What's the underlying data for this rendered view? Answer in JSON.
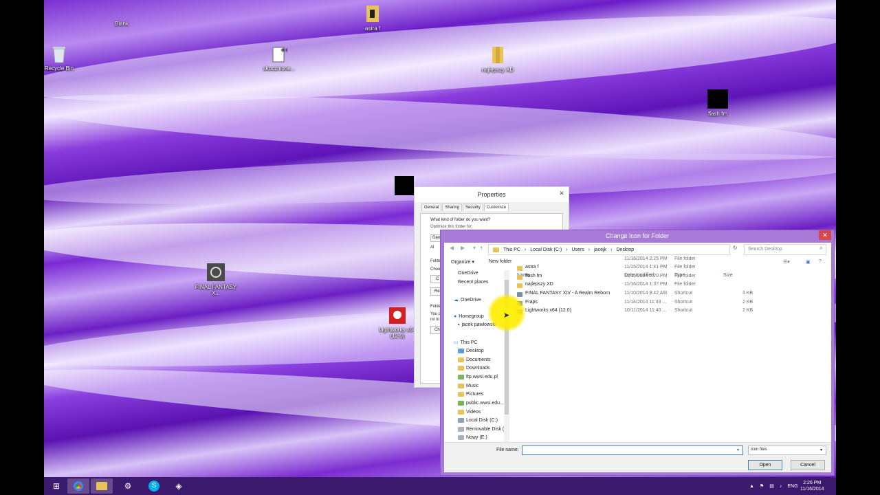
{
  "desktop": {
    "icons": [
      {
        "label": "Blank",
        "icon": "blank-file-icon"
      },
      {
        "label": "astra f",
        "icon": "music-folder-icon"
      },
      {
        "label": "Recycle Bin",
        "icon": "recycle-bin-icon"
      },
      {
        "label": "skocznione...",
        "icon": "document-icon"
      },
      {
        "label": "najlepszy XD",
        "icon": "folder-icon"
      },
      {
        "label": "flash fm",
        "icon": "black-square-icon"
      },
      {
        "label": "FINAL FANTASY X...",
        "icon": "game-icon"
      },
      {
        "label": "Lightworks x64 (12.0)",
        "icon": "lightworks-icon"
      }
    ]
  },
  "properties": {
    "title": "Properties",
    "tabs": [
      "General",
      "Sharing",
      "Security",
      "Customize"
    ],
    "question": "What kind of folder do you want?",
    "optimize_label": "Optimize this folder for:",
    "frag_gen": "Gen",
    "frag_all": "Al",
    "frag_folder": "Folde",
    "frag_choo": "Choo",
    "frag_c1": "C",
    "frag_r": "Re",
    "frag_folder2": "Folde",
    "frag_you": "You c",
    "frag_nolo": "no lo",
    "frag_ch": "Ch"
  },
  "change_icon": {
    "title": "Change Icon for  Folder",
    "address_parts": [
      "This PC",
      "Local Disk (C:)",
      "Users",
      "jacejk",
      "Desktop"
    ],
    "search_placeholder": "Search Desktop",
    "organize_label": "Organize ▾",
    "new_folder_label": "New folder",
    "nav": [
      {
        "label": "OneDrive"
      },
      {
        "label": "Recent places"
      },
      {
        "label": "OneDrive"
      },
      {
        "label": "Homegroup"
      },
      {
        "label": "jacek pawlowski"
      },
      {
        "label": "This PC"
      },
      {
        "label": "Desktop"
      },
      {
        "label": "Documents"
      },
      {
        "label": "Downloads"
      },
      {
        "label": "ftp.wwsi.edu.pl"
      },
      {
        "label": "Music"
      },
      {
        "label": "Pictures"
      },
      {
        "label": "public.wwsi.edu..."
      },
      {
        "label": "Videos"
      },
      {
        "label": "Local Disk (C:)"
      },
      {
        "label": "Removable Disk ("
      },
      {
        "label": "Nowy (E:)"
      }
    ],
    "columns": {
      "name": "Name",
      "date": "Date modified",
      "type": "Type",
      "size": "Size"
    },
    "files": [
      {
        "name": "",
        "date": "11/16/2014 2:25 PM",
        "type": "File folder",
        "size": ""
      },
      {
        "name": "astra f",
        "date": "11/15/2014 1:41 PM",
        "type": "File folder",
        "size": ""
      },
      {
        "name": "flash fm",
        "date": "11/16/2014 2:20 PM",
        "type": "File folder",
        "size": ""
      },
      {
        "name": "najlepszy XD",
        "date": "11/16/2014 1:37 PM",
        "type": "File folder",
        "size": ""
      },
      {
        "name": "FINAL FANTASY XIV - A Realm Reborn",
        "date": "11/10/2014 8:42 AM",
        "type": "Shortcut",
        "size": "3 KB"
      },
      {
        "name": "Fraps",
        "date": "11/14/2014 11:43 ...",
        "type": "Shortcut",
        "size": "2 KB"
      },
      {
        "name": "Lightworks x64 (12.0)",
        "date": "10/11/2014 11:40 ...",
        "type": "Shortcut",
        "size": "2 KB"
      }
    ],
    "file_name_label": "File name:",
    "file_name_value": "",
    "filter_value": "Icon files",
    "open_label": "Open",
    "cancel_label": "Cancel"
  },
  "taskbar": {
    "apps": [
      "start-icon",
      "chrome-icon",
      "file-explorer-icon",
      "steam-icon",
      "skype-icon",
      "app-icon"
    ],
    "lang": "ENG",
    "time": "2:26 PM",
    "date": "11/16/2014"
  }
}
